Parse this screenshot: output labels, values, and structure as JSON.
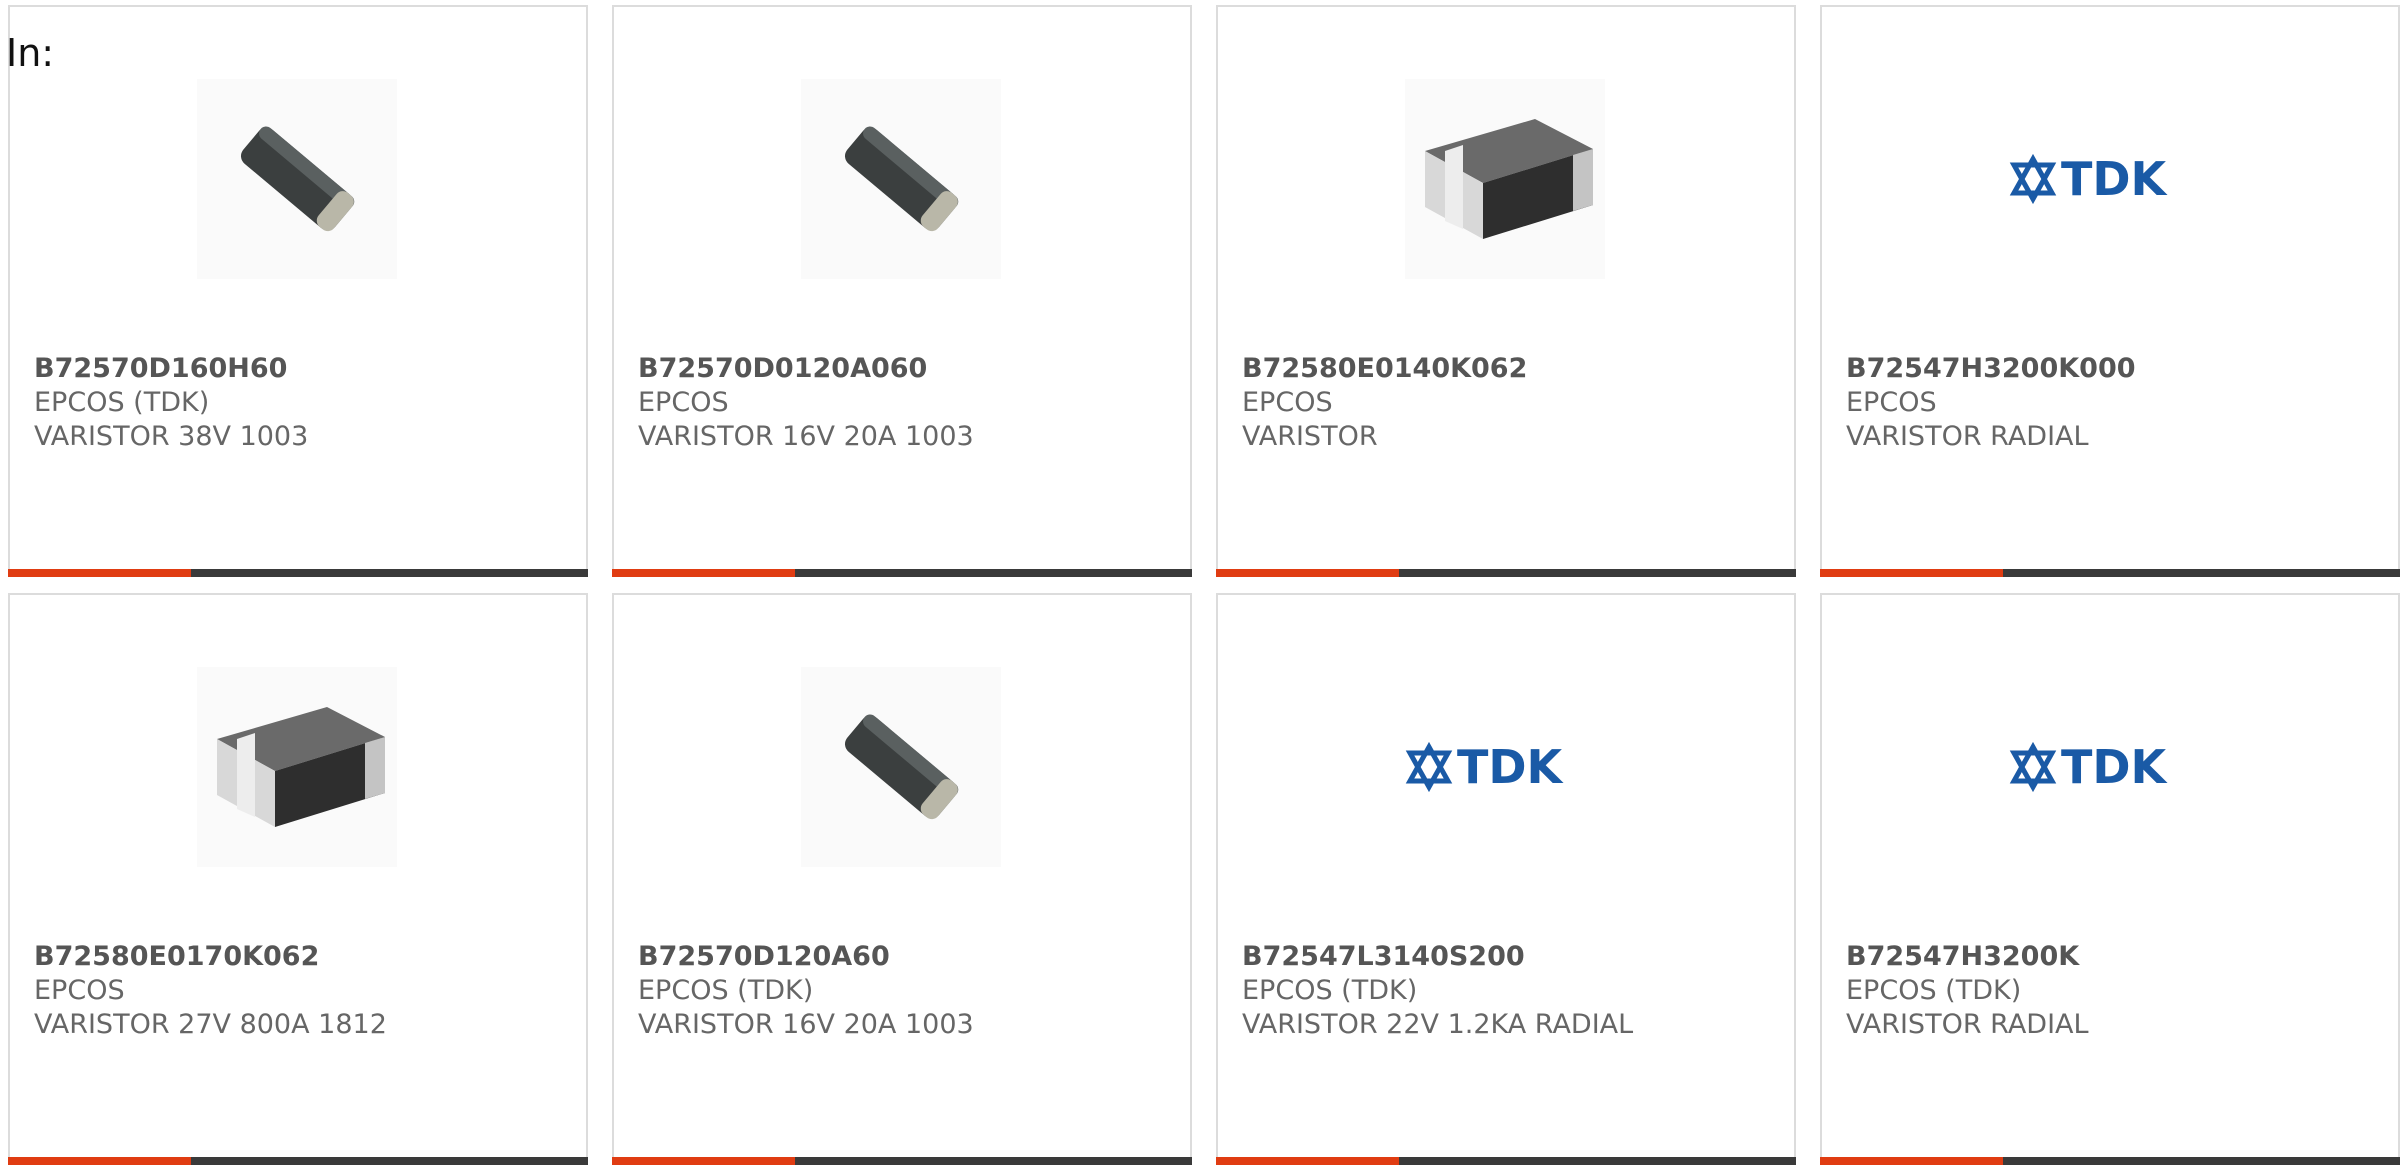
{
  "header": {
    "label": "In:"
  },
  "colors": {
    "accent": "#e03c12",
    "bar": "#3a3a3a",
    "tdk_blue": "#1a5aa6"
  },
  "cards": [
    {
      "part": "B72570D160H60",
      "manufacturer": "EPCOS (TDK)",
      "description": "VARISTOR 38V 1003",
      "image": "varistor-diagonal"
    },
    {
      "part": "B72570D0120A060",
      "manufacturer": "EPCOS",
      "description": "VARISTOR 16V 20A 1003",
      "image": "varistor-diagonal"
    },
    {
      "part": "B72580E0140K062",
      "manufacturer": "EPCOS",
      "description": "VARISTOR",
      "image": "smd-chip"
    },
    {
      "part": "B72547H3200K000",
      "manufacturer": "EPCOS",
      "description": "VARISTOR RADIAL",
      "image": "tdk-logo",
      "logo_text": "TDK"
    },
    {
      "part": "B72580E0170K062",
      "manufacturer": "EPCOS",
      "description": "VARISTOR 27V 800A 1812",
      "image": "smd-chip"
    },
    {
      "part": "B72570D120A60",
      "manufacturer": "EPCOS (TDK)",
      "description": "VARISTOR 16V 20A 1003",
      "image": "varistor-diagonal"
    },
    {
      "part": "B72547L3140S200",
      "manufacturer": "EPCOS (TDK)",
      "description": "VARISTOR 22V 1.2KA RADIAL",
      "image": "tdk-logo",
      "logo_text": "TDK"
    },
    {
      "part": "B72547H3200K",
      "manufacturer": "EPCOS (TDK)",
      "description": "VARISTOR RADIAL",
      "image": "tdk-logo",
      "logo_text": "TDK"
    }
  ]
}
